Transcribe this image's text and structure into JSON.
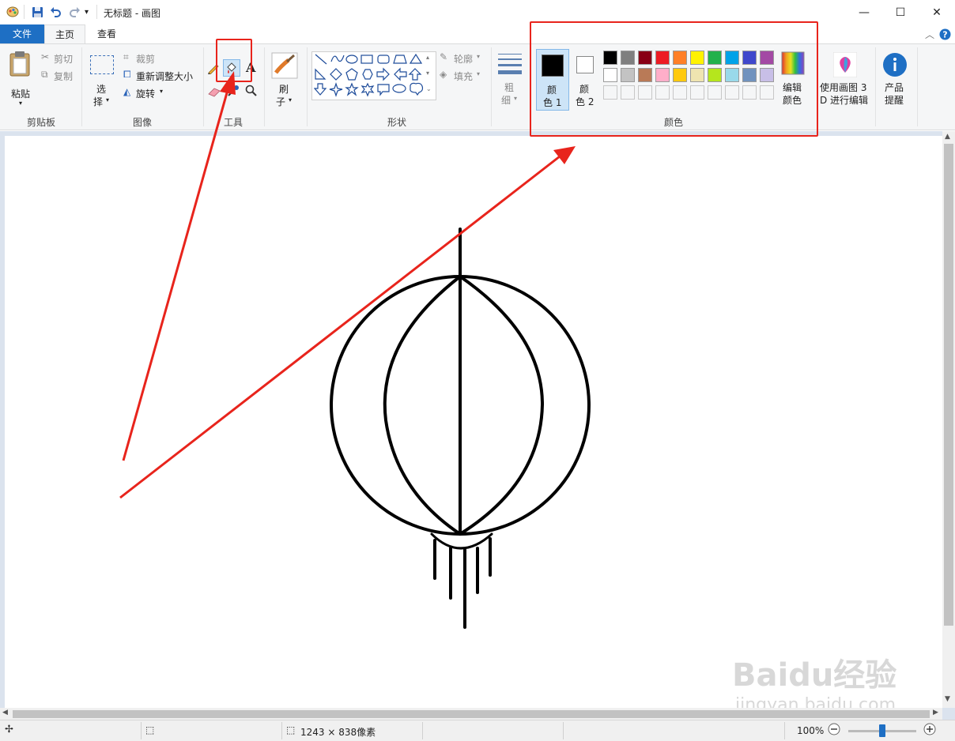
{
  "window": {
    "title": "无标题 - 画图",
    "minimize": "—",
    "maximize": "☐",
    "close": "✕"
  },
  "tabs": {
    "file": "文件",
    "home": "主页",
    "view": "查看"
  },
  "ribbon": {
    "clipboard": {
      "paste": "粘贴",
      "cut": "剪切",
      "copy": "复制",
      "label": "剪贴板"
    },
    "image": {
      "select_1": "选",
      "select_2": "择",
      "crop": "裁剪",
      "resize": "重新调整大小",
      "rotate": "旋转",
      "label": "图像"
    },
    "tools": {
      "label": "工具",
      "text_icon": "A"
    },
    "brushes": {
      "label_1": "刷",
      "label_2": "子"
    },
    "shapes": {
      "outline": "轮廓",
      "fill": "填充",
      "label": "形状"
    },
    "size": {
      "label_1": "粗",
      "label_2": "细"
    },
    "colors": {
      "color1_1": "颜",
      "color1_2": "色 1",
      "color2_1": "颜",
      "color2_2": "色 2",
      "edit_1": "编辑",
      "edit_2": "颜色",
      "label": "颜色",
      "color1_value": "#000000",
      "color2_value": "#ffffff",
      "row1": [
        "#000000",
        "#7f7f7f",
        "#880015",
        "#ed1c24",
        "#ff7f27",
        "#fff200",
        "#22b14c",
        "#00a2e8",
        "#3f48cc",
        "#a349a4"
      ],
      "row2": [
        "#ffffff",
        "#c3c3c3",
        "#b97a57",
        "#ffaec9",
        "#ffc90e",
        "#efe4b0",
        "#b5e61d",
        "#99d9ea",
        "#7092be",
        "#c8bfe7"
      ]
    },
    "paint3d": {
      "line1": "使用画图 3",
      "line2": "D 进行编辑"
    },
    "tips": {
      "line1": "产品",
      "line2": "提醒"
    }
  },
  "statusbar": {
    "size_text": "1243 × 838像素",
    "zoom": "100%",
    "zoom_level": 0.5
  },
  "annotation": {
    "highlight_color": "#e8241c"
  },
  "watermark": {
    "brand": "Baidu经验",
    "url": "jingyan.baidu.com"
  }
}
